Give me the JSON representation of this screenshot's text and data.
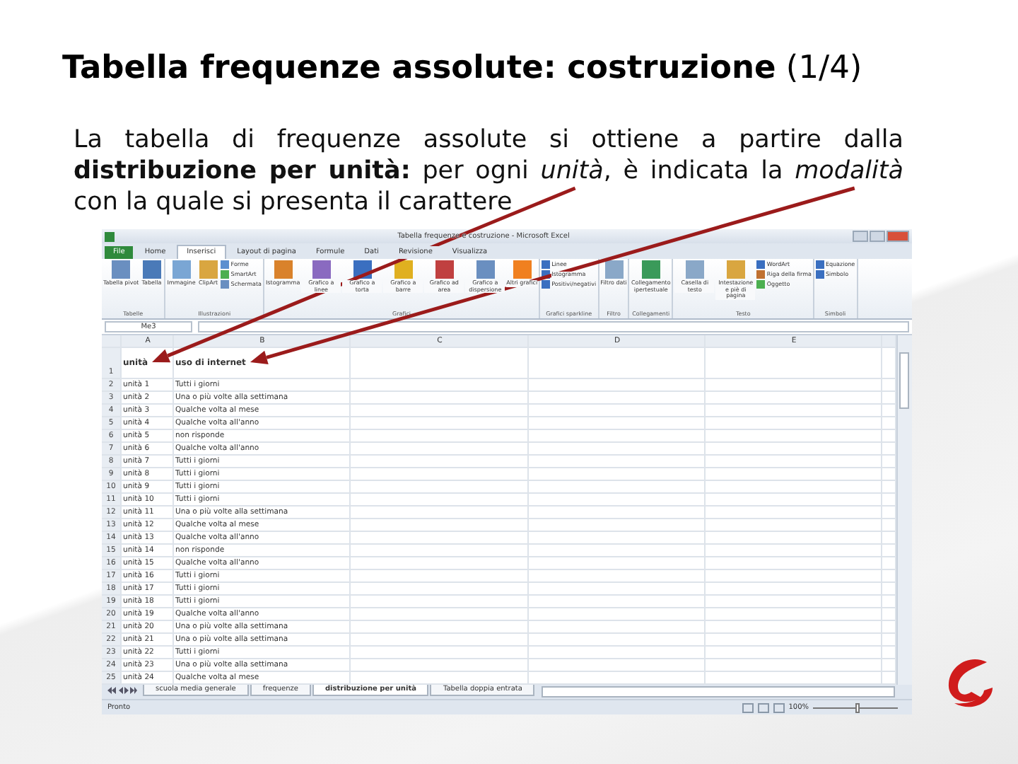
{
  "slide": {
    "title": "**Tabella frequenze assolute: costruzione** (1/4)",
    "text": "La tabella di frequenze assolute si ottiene a partire dalla **distribuzione per unità:** per ogni *unità*, è indicata la *modalità* con la quale si presenta il carattere"
  },
  "excel": {
    "window_title": "Tabella frequenze e costruzione - Microsoft Excel",
    "ribbon_tabs": [
      {
        "label": "File",
        "selected": false,
        "kind": "file"
      },
      {
        "label": "Home",
        "selected": false,
        "kind": "tab"
      },
      {
        "label": "Inserisci",
        "selected": true,
        "kind": "tab"
      },
      {
        "label": "Layout di pagina",
        "selected": false,
        "kind": "tab"
      },
      {
        "label": "Formule",
        "selected": false,
        "kind": "tab"
      },
      {
        "label": "Dati",
        "selected": false,
        "kind": "tab"
      },
      {
        "label": "Revisione",
        "selected": false,
        "kind": "tab"
      },
      {
        "label": "Visualizza",
        "selected": false,
        "kind": "tab"
      }
    ],
    "ribbon_groups": [
      {
        "label": "Tabelle",
        "items": [
          {
            "label": "Tabella pivot",
            "kind": "large",
            "color": "#6a8fc0"
          },
          {
            "label": "Tabella",
            "kind": "large",
            "color": "#4a7ab8"
          }
        ]
      },
      {
        "label": "Illustrazioni",
        "items": [
          {
            "label": "Immagine",
            "kind": "large",
            "color": "#7aa6d4"
          },
          {
            "label": "ClipArt",
            "kind": "large",
            "color": "#d9a640"
          },
          {
            "label": "Forme",
            "kind": "small",
            "color": "#5b8fd0"
          },
          {
            "label": "SmartArt",
            "kind": "small",
            "color": "#4caf50"
          },
          {
            "label": "Schermata",
            "kind": "small",
            "color": "#6a8fc0"
          }
        ]
      },
      {
        "label": "Grafici",
        "items": [
          {
            "label": "Istogramma",
            "kind": "large",
            "color": "#d9822b"
          },
          {
            "label": "Grafico a linee",
            "kind": "large",
            "color": "#8a6ac0"
          },
          {
            "label": "Grafico a torta",
            "kind": "large",
            "color": "#3a6fc0"
          },
          {
            "label": "Grafico a barre",
            "kind": "large",
            "color": "#e0b020"
          },
          {
            "label": "Grafico ad area",
            "kind": "large",
            "color": "#c04040"
          },
          {
            "label": "Grafico a dispersione",
            "kind": "large",
            "color": "#6a8fc0"
          },
          {
            "label": "Altri grafici",
            "kind": "large",
            "color": "#f08020"
          }
        ]
      },
      {
        "label": "Grafici sparkline",
        "items": [
          {
            "label": "Linee",
            "kind": "small",
            "color": "#3a6fc0"
          },
          {
            "label": "Istogramma",
            "kind": "small",
            "color": "#3a6fc0"
          },
          {
            "label": "Positivi/negativi",
            "kind": "small",
            "color": "#3a6fc0"
          }
        ]
      },
      {
        "label": "Filtro",
        "items": [
          {
            "label": "Filtro dati",
            "kind": "large",
            "color": "#8aa8c8"
          }
        ]
      },
      {
        "label": "Collegamenti",
        "items": [
          {
            "label": "Collegamento ipertestuale",
            "kind": "large",
            "color": "#3a9a5a"
          }
        ]
      },
      {
        "label": "Testo",
        "items": [
          {
            "label": "Casella di testo",
            "kind": "large",
            "color": "#8aa8c8"
          },
          {
            "label": "Intestazione e piè di pagina",
            "kind": "large",
            "color": "#d9a640"
          },
          {
            "label": "WordArt",
            "kind": "small",
            "color": "#3a6fc0"
          },
          {
            "label": "Riga della firma",
            "kind": "small",
            "color": "#c07030"
          },
          {
            "label": "Oggetto",
            "kind": "small",
            "color": "#4caf50"
          }
        ]
      },
      {
        "label": "Simboli",
        "items": [
          {
            "label": "Equazione",
            "kind": "small",
            "color": "#3a6fc0"
          },
          {
            "label": "Simbolo",
            "kind": "small",
            "color": "#3a6fc0"
          }
        ]
      }
    ],
    "name_box": "Me3",
    "columns": [
      "A",
      "B",
      "C",
      "D",
      "E"
    ],
    "rows": [
      {
        "number": "1",
        "cells": [
          "unità",
          "uso di internet"
        ],
        "header": true
      },
      {
        "number": "2",
        "cells": [
          "unità 1",
          "Tutti i giorni"
        ],
        "header": false
      },
      {
        "number": "3",
        "cells": [
          "unità 2",
          "Una o più volte alla settimana"
        ],
        "header": false
      },
      {
        "number": "4",
        "cells": [
          "unità 3",
          "Qualche volta al mese"
        ],
        "header": false
      },
      {
        "number": "5",
        "cells": [
          "unità 4",
          "Qualche volta all'anno"
        ],
        "header": false
      },
      {
        "number": "6",
        "cells": [
          "unità 5",
          "non risponde"
        ],
        "header": false
      },
      {
        "number": "7",
        "cells": [
          "unità 6",
          "Qualche volta all'anno"
        ],
        "header": false
      },
      {
        "number": "8",
        "cells": [
          "unità 7",
          "Tutti i giorni"
        ],
        "header": false
      },
      {
        "number": "9",
        "cells": [
          "unità 8",
          "Tutti i giorni"
        ],
        "header": false
      },
      {
        "number": "10",
        "cells": [
          "unità 9",
          "Tutti i giorni"
        ],
        "header": false
      },
      {
        "number": "11",
        "cells": [
          "unità 10",
          "Tutti i giorni"
        ],
        "header": false
      },
      {
        "number": "12",
        "cells": [
          "unità 11",
          "Una o più volte alla settimana"
        ],
        "header": false
      },
      {
        "number": "13",
        "cells": [
          "unità 12",
          "Qualche volta al mese"
        ],
        "header": false
      },
      {
        "number": "14",
        "cells": [
          "unità 13",
          "Qualche volta all'anno"
        ],
        "header": false
      },
      {
        "number": "15",
        "cells": [
          "unità 14",
          "non risponde"
        ],
        "header": false
      },
      {
        "number": "16",
        "cells": [
          "unità 15",
          "Qualche volta all'anno"
        ],
        "header": false
      },
      {
        "number": "17",
        "cells": [
          "unità 16",
          "Tutti i giorni"
        ],
        "header": false
      },
      {
        "number": "18",
        "cells": [
          "unità 17",
          "Tutti i giorni"
        ],
        "header": false
      },
      {
        "number": "19",
        "cells": [
          "unità 18",
          "Tutti i giorni"
        ],
        "header": false
      },
      {
        "number": "20",
        "cells": [
          "unità 19",
          "Qualche volta all'anno"
        ],
        "header": false
      },
      {
        "number": "21",
        "cells": [
          "unità 20",
          "Una o più volte alla settimana"
        ],
        "header": false
      },
      {
        "number": "22",
        "cells": [
          "unità 21",
          "Una o più volte alla settimana"
        ],
        "header": false
      },
      {
        "number": "23",
        "cells": [
          "unità 22",
          "Tutti i giorni"
        ],
        "header": false
      },
      {
        "number": "24",
        "cells": [
          "unità 23",
          "Una o più volte alla settimana"
        ],
        "header": false
      },
      {
        "number": "25",
        "cells": [
          "unità 24",
          "Qualche volta al mese"
        ],
        "header": false
      }
    ],
    "sheet_tabs": [
      {
        "label": "scuola media generale",
        "selected": false
      },
      {
        "label": "frequenze",
        "selected": false
      },
      {
        "label": "distribuzione per unità",
        "selected": true
      },
      {
        "label": "Tabella doppia entrata",
        "selected": false
      }
    ],
    "status": "Pronto",
    "zoom": "100%",
    "zoom_slider": {
      "level": 0.5
    }
  }
}
